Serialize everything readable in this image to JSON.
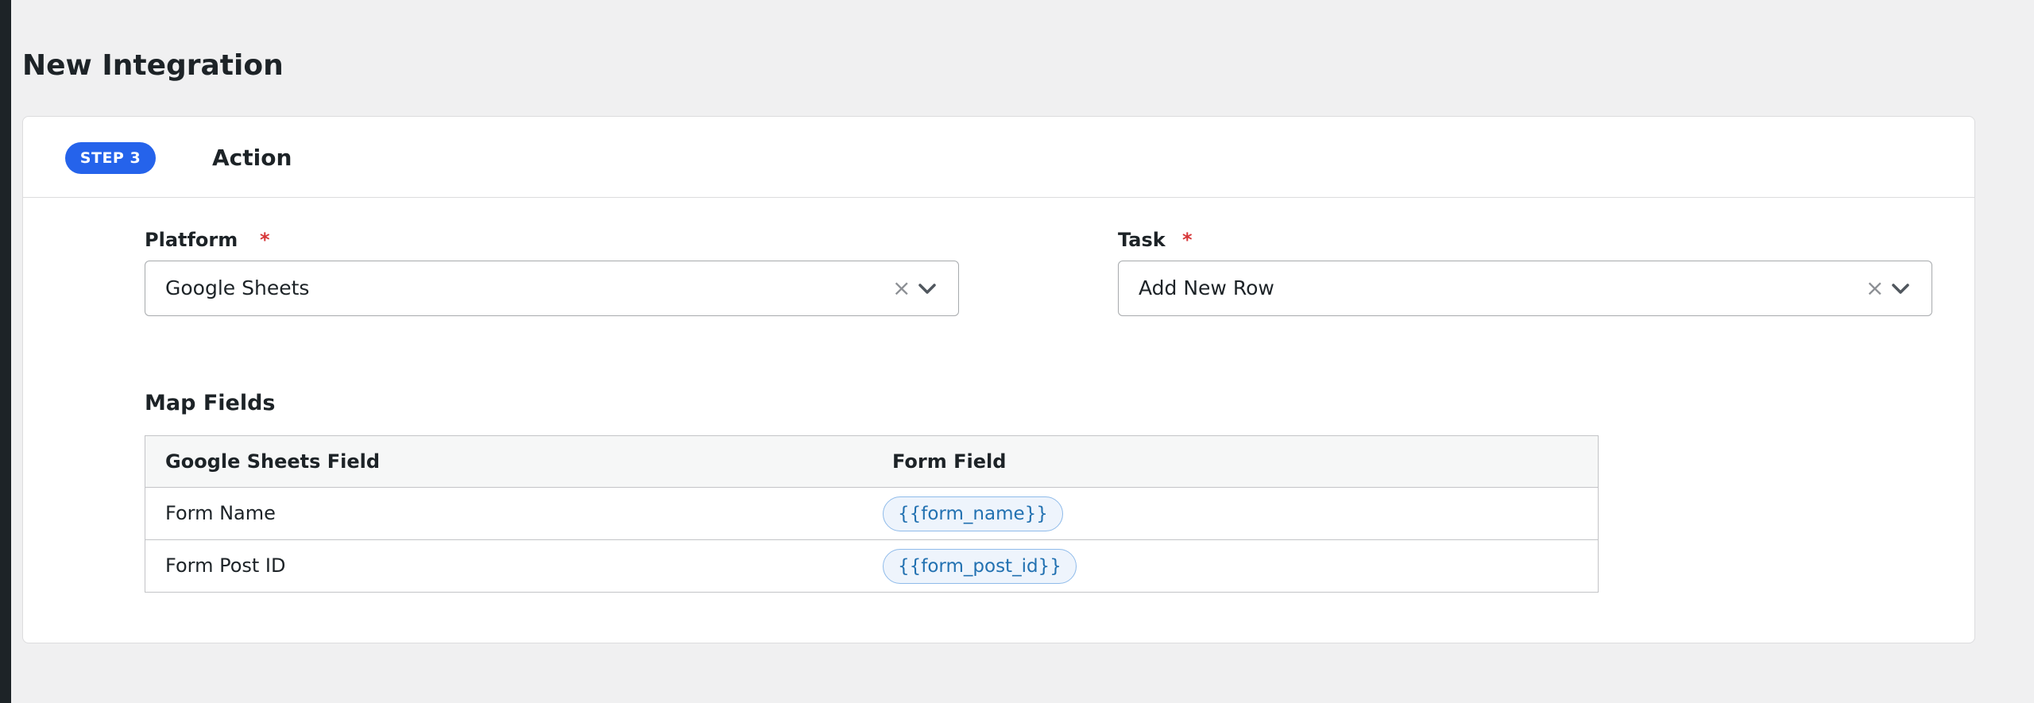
{
  "page": {
    "title": "New Integration"
  },
  "card": {
    "step_badge": "STEP 3",
    "title": "Action"
  },
  "fields": {
    "platform": {
      "label": "Platform",
      "required_mark": "*",
      "value": "Google Sheets",
      "clear_glyph": "×"
    },
    "task": {
      "label": "Task",
      "required_mark": "*",
      "value": "Add New Row",
      "clear_glyph": "×"
    }
  },
  "map_fields": {
    "title": "Map Fields",
    "columns": [
      "Google Sheets Field",
      "Form Field"
    ],
    "rows": [
      {
        "sheet_field": "Form Name",
        "form_field": "{{form_name}}"
      },
      {
        "sheet_field": "Form Post ID",
        "form_field": "{{form_post_id}}"
      }
    ]
  },
  "colors": {
    "accent": "#2563eb",
    "required": "#d63638",
    "chip_text": "#2271b1"
  },
  "icons": {
    "select_clear": "close-icon",
    "select_toggle": "chevron-down-icon"
  }
}
